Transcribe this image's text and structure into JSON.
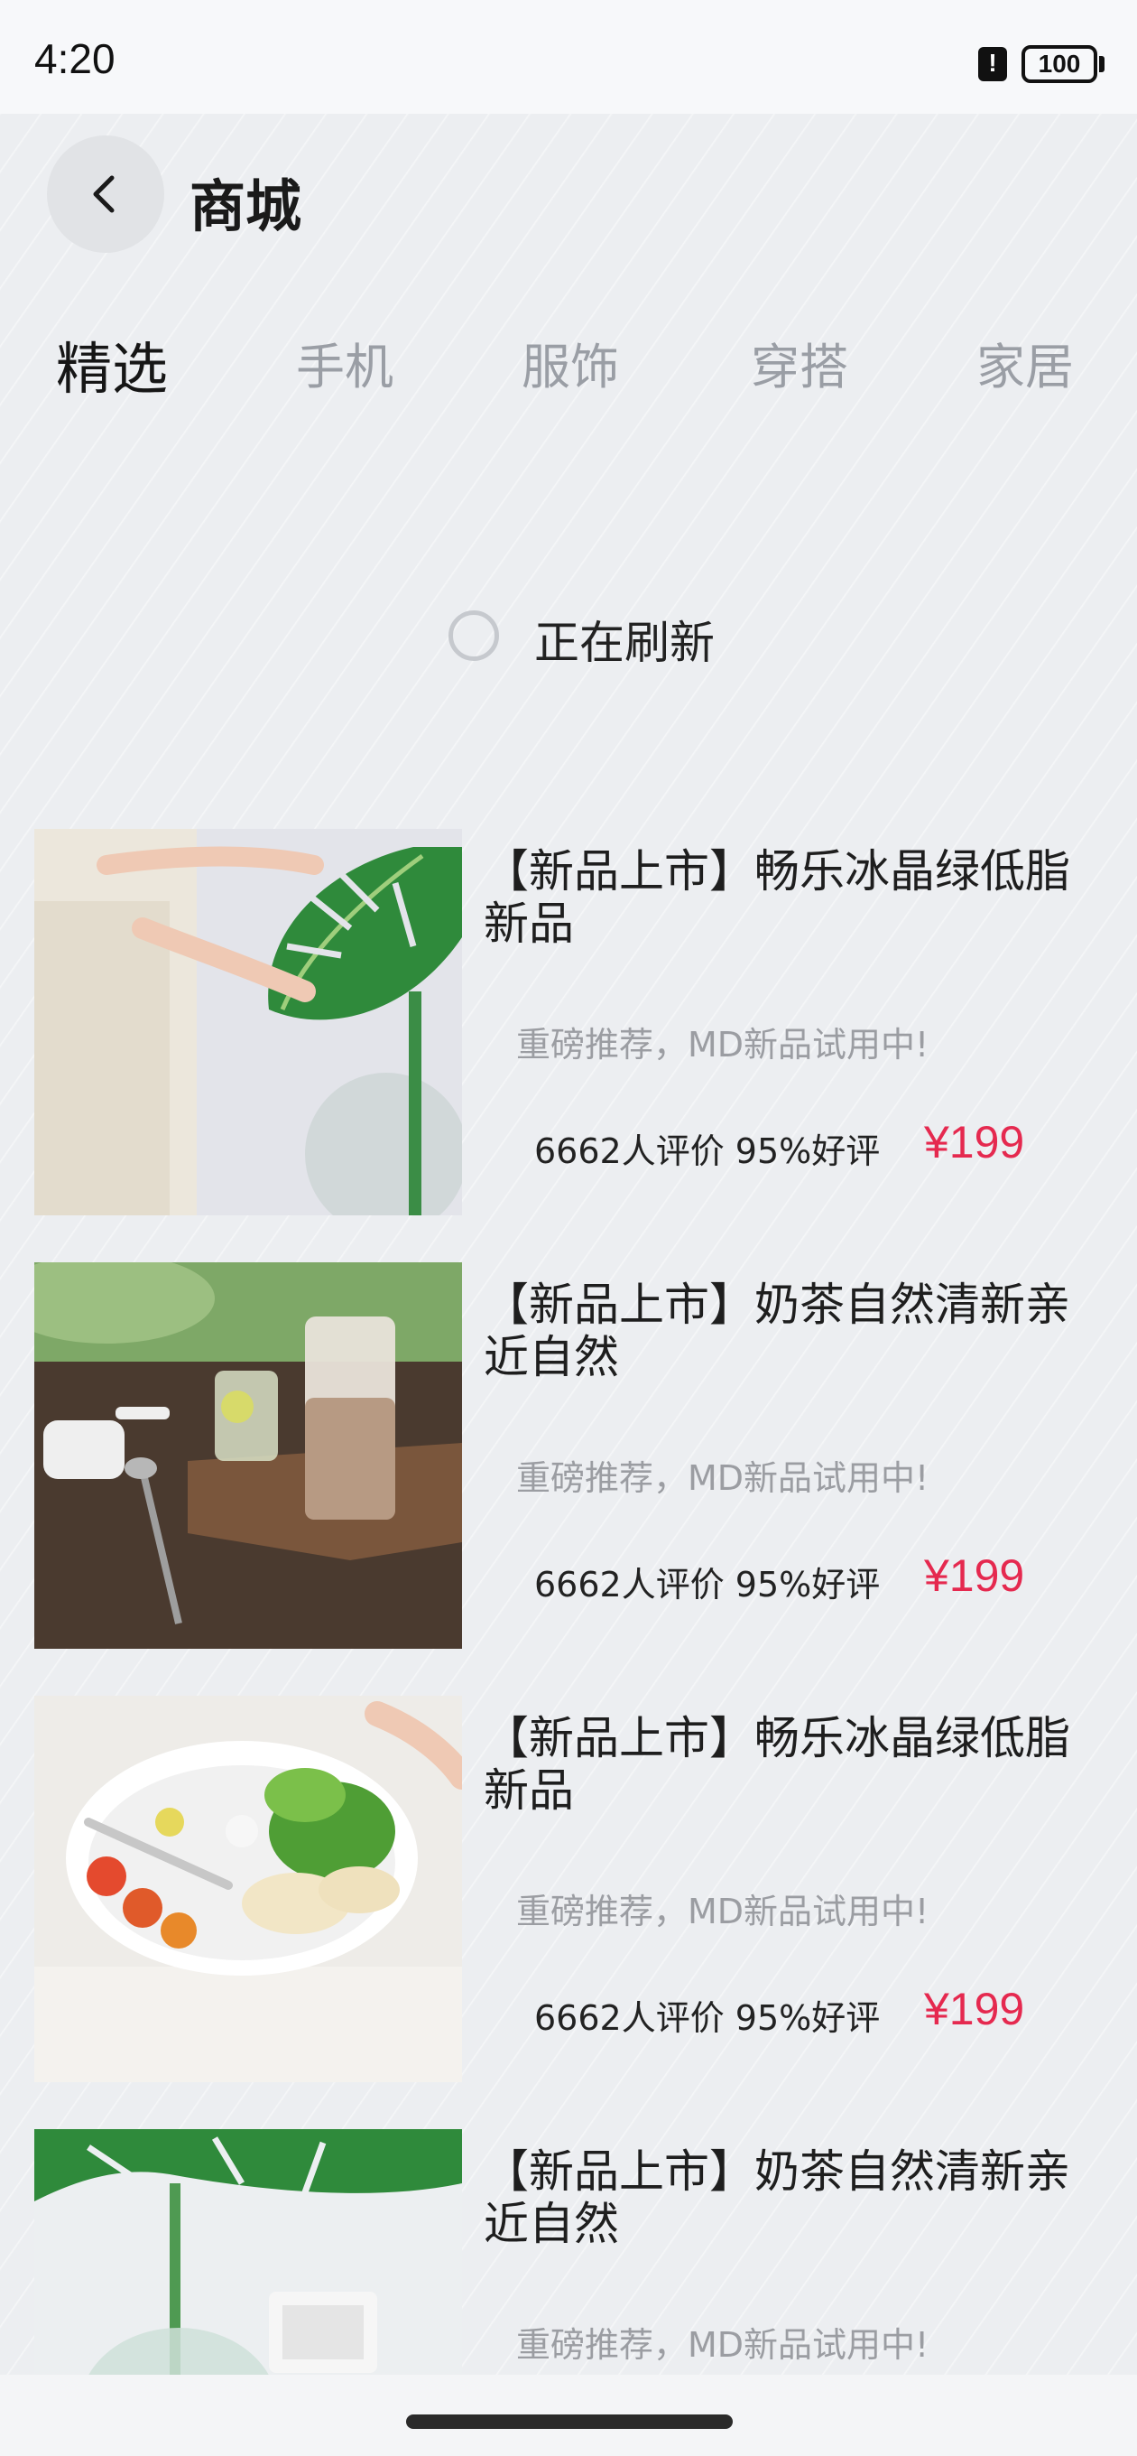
{
  "status_bar": {
    "time": "4:20",
    "alert_glyph": "!",
    "battery": "100"
  },
  "header": {
    "title": "商城",
    "back_icon": "chevron-left-icon"
  },
  "tabs": [
    {
      "label": "精选",
      "active": true
    },
    {
      "label": "手机",
      "active": false
    },
    {
      "label": "服饰",
      "active": false
    },
    {
      "label": "穿搭",
      "active": false
    },
    {
      "label": "家居",
      "active": false
    }
  ],
  "refresh": {
    "text": "正在刷新"
  },
  "products": [
    {
      "title": "【新品上市】畅乐冰晶绿低脂新品",
      "subtitle": "重磅推荐，MD新品试用中!",
      "reviews": "6662人评价 95%好评",
      "price": "¥199",
      "image": "hands-holding-monstera-leaf"
    },
    {
      "title": "【新品上市】奶茶自然清新亲近自然",
      "subtitle": "重磅推荐，MD新品试用中!",
      "reviews": "6662人评价 95%好评",
      "price": "¥199",
      "image": "milk-tea-glass-on-wooden-table"
    },
    {
      "title": "【新品上市】畅乐冰晶绿低脂新品",
      "subtitle": "重磅推荐，MD新品试用中!",
      "reviews": "6662人评价 95%好评",
      "price": "¥199",
      "image": "salad-plate-with-fork"
    },
    {
      "title": "【新品上市】奶茶自然清新亲近自然",
      "subtitle": "重磅推荐，MD新品试用中!",
      "reviews": "",
      "price": "",
      "image": "monstera-leaf-in-glass-vase"
    }
  ],
  "colors": {
    "price": "#e5294f",
    "active_tab": "#161616",
    "inactive_tab": "#9a9ea5"
  }
}
